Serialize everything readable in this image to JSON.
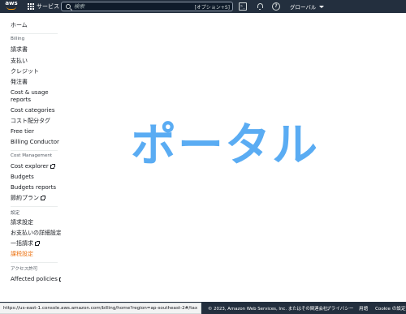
{
  "topbar": {
    "logo_text": "aws",
    "services_label": "サービス",
    "search_placeholder": "検索",
    "search_shortcut": "[オプション+S]",
    "cloudshell_glyph": ">_",
    "help_glyph": "?",
    "region_label": "グローバル"
  },
  "sidebar": {
    "home": "ホーム",
    "sections": [
      {
        "header": "Billing",
        "items": [
          {
            "label": "請求書"
          },
          {
            "label": "支払い"
          },
          {
            "label": "クレジット"
          },
          {
            "label": "発注書"
          },
          {
            "label": "Cost & usage reports"
          },
          {
            "label": "Cost categories"
          },
          {
            "label": "コスト配分タグ"
          },
          {
            "label": "Free tier"
          },
          {
            "label": "Billing Conductor",
            "external": true
          }
        ]
      },
      {
        "header": "Cost Management",
        "items": [
          {
            "label": "Cost explorer",
            "external": true
          },
          {
            "label": "Budgets"
          },
          {
            "label": "Budgets reports"
          },
          {
            "label": "節約プラン",
            "external": true
          }
        ]
      },
      {
        "header": "設定",
        "items": [
          {
            "label": "請求設定"
          },
          {
            "label": "お支払いの詳細設定"
          },
          {
            "label": "一括請求",
            "external": true
          },
          {
            "label": "課税設定",
            "active": true
          }
        ]
      },
      {
        "header": "アクセス許可",
        "items": [
          {
            "label": "Affected policies",
            "external": true
          }
        ]
      }
    ]
  },
  "main": {
    "overlay_text": "ポータル"
  },
  "footer": {
    "status_url": "https://us-east-1.console.aws.amazon.com/billing/home?region=ap-southeast-2#/tax",
    "copyright": "© 2023, Amazon Web Services, Inc. またはその関連会社。",
    "privacy": "プライバシー",
    "terms": "用語",
    "cookie": "Cookie の設定"
  },
  "colors": {
    "topbar_bg": "#232f3e",
    "accent": "#ff9900",
    "active_link": "#ec7211",
    "overlay_text": "#5aacf3"
  }
}
